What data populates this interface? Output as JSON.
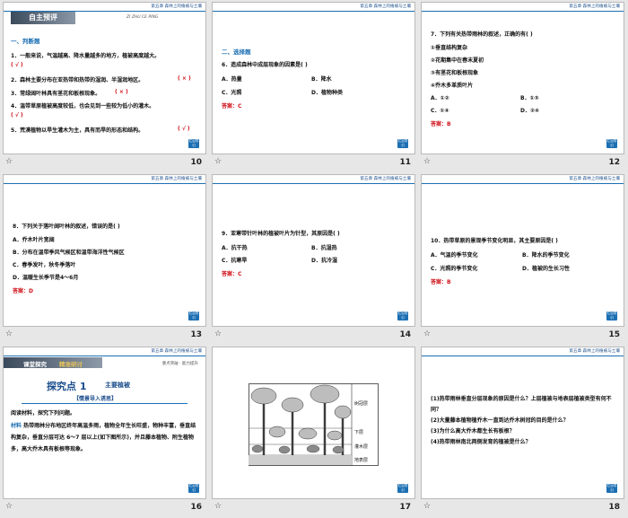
{
  "header_chapter": "第五章  森林上的植被与土壤",
  "foot_button": "栏目导引",
  "star": "☆",
  "slides": [
    {
      "number": "10",
      "banner_title": "自主预评",
      "banner_pinyin": "ZI ZHU CE PING",
      "section": "一、判断题",
      "lines": [
        {
          "text": "1．一般来说，气温越高、降水量越多的地方，植被高度越大。",
          "mark": "(  √  )"
        },
        {
          "text": "2．森林主要分布在亚热带和热带的湿润、半湿润地区。",
          "mark": "(  ×  )"
        },
        {
          "text": "3．常绿阔叶林具有茎花和板根现象。",
          "mark": "(  ×  )"
        },
        {
          "text": "4．温带草原植被高度较低，也会见到一些较为低小的灌木。",
          "mark": "(  √  )"
        },
        {
          "text": "5．荒漠植物以旱生灌木为主，具有而旱的形态和结构。",
          "mark": "(  √  )"
        }
      ]
    },
    {
      "number": "11",
      "section": "二、选择题",
      "question": "6．造成森林中成层现象的因素是(      )",
      "options": [
        "A．热量",
        "B．降水",
        "C．光照",
        "D．植物种类"
      ],
      "answer": "答案：C"
    },
    {
      "number": "12",
      "question": "7．下列有关热带雨林的叙述，正确的有(      )",
      "items": [
        "①垂直结构复杂",
        "②花期集中在春末夏初",
        "③有茎花和板根现象",
        "④乔木多革质叶片"
      ],
      "options": [
        "A．①②",
        "B．①③",
        "C．①④",
        "D．②④"
      ],
      "answer": "答案：B"
    },
    {
      "number": "13",
      "question": "8．下列关于落叶阔叶林的叙述，错误的是(      )",
      "options": [
        "A．乔木叶片宽阔",
        "B．分布在温带季风气候区和温带海洋性气候区",
        "C．春季发叶，秋冬季落叶",
        "D．温暖生长季节是4～6月"
      ],
      "answer": "答案：D"
    },
    {
      "number": "14",
      "question": "9．亚寒带针叶林的植被叶片为针型，其原因是(      )",
      "options": [
        "A．抗干热",
        "B．抗湿热",
        "C．抗寒旱",
        "D．抗冷湿"
      ],
      "answer": "答案：C"
    },
    {
      "number": "15",
      "question": "10．热带草原的景观季节变化明显，其主要原因是(      )",
      "options": [
        "A．气温的季节变化",
        "B．降水的季节变化",
        "C．光照的季节变化",
        "D．植被的生长习性"
      ],
      "answer": "答案：B"
    },
    {
      "number": "16",
      "banner_title": "课堂探究",
      "banner_sub": "精准研讨",
      "banner_right": "重点突破 · 能力提升",
      "topic_num": "探究点 1",
      "topic_title": "主要植被",
      "lead": "【情景导入诱思】",
      "intro": "阅读材料，探究下列问题。",
      "material_label": "材料",
      "material": "热带雨林分布地区终年高温多雨，植物全年生长旺盛，物种丰富，垂直结构复杂，垂直分层可达 6～7 层以上(如下图所示)，并且藤本植物、附生植物多，高大乔木具有板根等现象。"
    },
    {
      "number": "17",
      "layers": [
        "树冠层",
        "下层",
        "灌木层",
        "地表层"
      ]
    },
    {
      "number": "18",
      "questions": [
        "(1)热带雨林垂直分层现象的原因是什么？上层植被与地表层植被类型有何不同？",
        "(2)大量藤本植物植乔木一直到达乔木树冠的目的是什么？",
        "(3)为什么高大乔木都生长有板根？",
        "(4)热带雨林南北两侧发育的植被是什么？"
      ]
    }
  ]
}
